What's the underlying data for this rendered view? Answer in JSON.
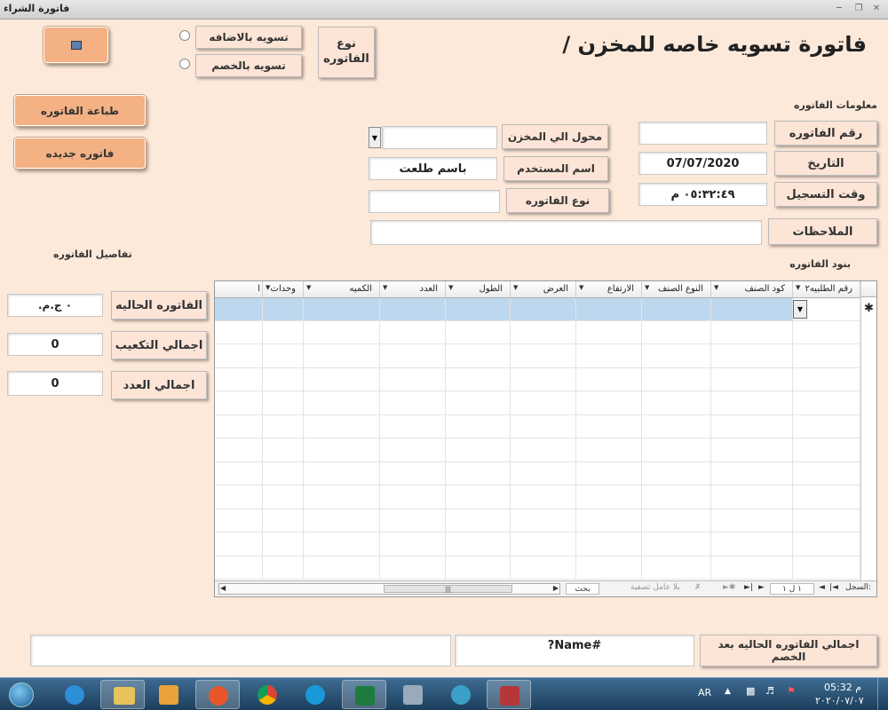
{
  "window": {
    "title": "فاتورة الشراء"
  },
  "header": {
    "title": "فاتورة تسويه خاصه للمخزن /",
    "invoice_type_label": "نوع الفاتوره",
    "radio_add_label": "تسويه بالاضافه",
    "radio_sub_label": "تسويه بالخصم"
  },
  "actions": {
    "print_label": "طباعة الفاتوره",
    "new_label": "فاتوره جديده"
  },
  "info": {
    "section_label": "معلومات الفاتوره",
    "invoice_no_label": "رقم الفاتوره",
    "invoice_no_value": "",
    "date_label": "التاريخ",
    "date_value": "07/07/2020",
    "reg_time_label": "وقت التسجيل",
    "reg_time_value": "٠٥:٣٢:٤٩ م",
    "transfer_to_label": "محول الي  المخزن",
    "transfer_to_value": "",
    "username_label": "اسم المستخدم",
    "username_value": "باسم طلعت",
    "invoice_kind_label": "نوع الفاتوره",
    "invoice_kind_value": "",
    "notes_label": "الملاحظات",
    "notes_value": ""
  },
  "details": {
    "section_label": "تفاصيل الفاتوره",
    "current_invoice_label": "الفاتوره الحاليه",
    "current_invoice_value": "٠ ج.م.",
    "total_cubic_label": "اجمالي التكعيب",
    "total_cubic_value": "0",
    "total_count_label": "اجمالي العدد",
    "total_count_value": "0"
  },
  "items": {
    "section_label": "بنود الفاتوره",
    "columns": [
      "رقم الطلبيه٢",
      "كود الصنف",
      "النوع الصنف",
      "الارتفاع",
      "العرض",
      "الطول",
      "العدد",
      "الكميه",
      "وحدات",
      "ا"
    ],
    "rows": [],
    "nav": {
      "record_label": "السجل:",
      "position": "١ ل ١",
      "no_filter": "بلا عامل تصفية",
      "search": "بحث"
    }
  },
  "footer": {
    "after_discount_label": "اجمالي الفاتوره الحاليه بعد الخصم",
    "after_discount_value": "#Name?",
    "extra_value": ""
  },
  "taskbar": {
    "lang": "AR",
    "time": "05:32 م",
    "date": "٢٠٢٠/٠٧/٠٧"
  }
}
